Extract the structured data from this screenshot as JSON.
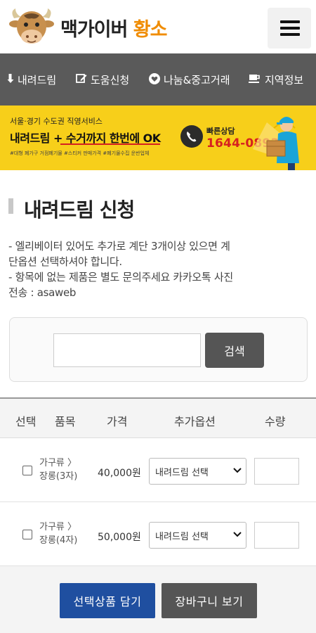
{
  "header": {
    "brand_part1": "맥가이버",
    "brand_part2": "황소",
    "menu_icon": "hamburger-menu-icon",
    "logo_icon": "bull-logo-icon"
  },
  "nav": {
    "items": [
      {
        "label": "내려드림",
        "icon": "arrow-down-icon"
      },
      {
        "label": "도움신청",
        "icon": "edit-icon"
      },
      {
        "label": "나눔&중고거래",
        "icon": "heart-icon"
      },
      {
        "label": "지역정보",
        "icon": "coffee-cup-icon"
      }
    ]
  },
  "banner": {
    "sub": "서울·경기 수도권 직영서비스",
    "main": "내려드림 + 수거까지 한번에 OK",
    "tags": "#대형 폐가구 거점폐기물   #스티커 판매가격   #폐기물수집 운반업체",
    "phone_label": "빠른상담",
    "phone": "1644-0893"
  },
  "page": {
    "title": "내려드림 신청",
    "notice_lines": [
      "- 엘리베이터 있어도 추가로 계단 3개이상 있으면 계",
      "단옵션 선택하셔야 합니다.",
      "- 항목에 없는 제품은 별도 문의주세요 카카오톡 사진",
      "전송 : asaweb"
    ]
  },
  "search": {
    "value": "",
    "placeholder": "",
    "button_label": "검색"
  },
  "table": {
    "headers": [
      "선택",
      "품목",
      "가격",
      "추가옵션",
      "수량"
    ],
    "rows": [
      {
        "name_line1": "가구류 〉",
        "name_line2": "장롱(3자)",
        "price": "40,000원",
        "option": "내려드림 선택",
        "qty": ""
      },
      {
        "name_line1": "가구류 〉",
        "name_line2": "장롱(4자)",
        "price": "50,000원",
        "option": "내려드림 선택",
        "qty": ""
      }
    ]
  },
  "actions": {
    "add_selected": "선택상품 담기",
    "view_cart": "장바구니 보기"
  },
  "colors": {
    "nav_bg": "#5a5a5a",
    "banner_bg": "#f7cf1a",
    "brand_accent": "#f08c00",
    "primary_button": "#1f4fa0",
    "phone_red": "#d62020"
  }
}
